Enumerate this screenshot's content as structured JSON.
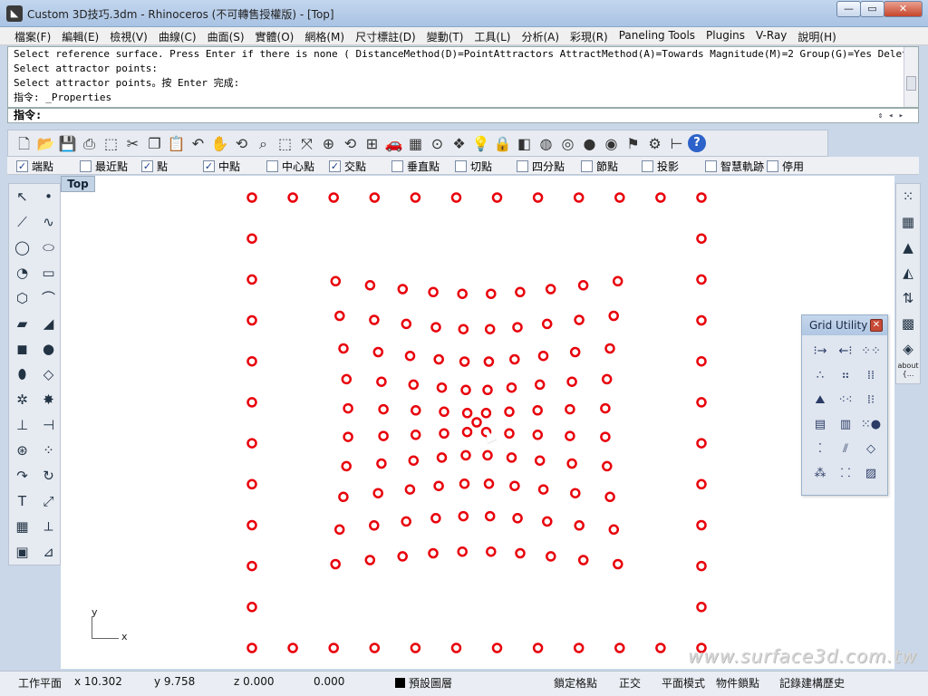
{
  "window": {
    "title": "Custom 3D技巧.3dm - Rhinoceros (不可轉售授權版) - [Top]",
    "app_icon": "rhino-icon",
    "buttons": [
      "—",
      "▭",
      "✕"
    ]
  },
  "menu": [
    "檔案(F)",
    "編輯(E)",
    "檢視(V)",
    "曲線(C)",
    "曲面(S)",
    "實體(O)",
    "網格(M)",
    "尺寸標註(D)",
    "變動(T)",
    "工具(L)",
    "分析(A)",
    "彩現(R)",
    "Paneling Tools",
    "Plugins",
    "V-Ray",
    "說明(H)"
  ],
  "command": {
    "history": [
      "Select reference surface. Press Enter if there is none ( DistanceMethod(D)=PointAttractors  AttractMethod(A)=Towards  Magnitude(M)=2  Group(G)=Yes  DeleteInput(E)=Y",
      "Select attractor points:",
      "Select attractor points。按 Enter 完成:",
      "指令: _Properties"
    ],
    "prompt": "指令:"
  },
  "toolbar_icons": [
    "new-file-icon",
    "open-file-icon",
    "save-icon",
    "print-icon",
    "import-icon",
    "cut-icon",
    "copy-icon",
    "paste-icon",
    "undo-icon",
    "pan-icon",
    "rotate-view-icon",
    "zoom-icon",
    "zoom-window-icon",
    "zoom-extents-icon",
    "zoom-selected-icon",
    "rotate-view-icon",
    "four-viewports-icon",
    "car-icon",
    "grid-icon",
    "point-icon",
    "layer-icon",
    "light-icon",
    "lock-icon",
    "shade-icon",
    "color-wheel-icon",
    "sphere-wire-icon",
    "sphere-icon",
    "sphere-render-icon",
    "flag-icon",
    "settings-icon",
    "tree-icon",
    "help-icon"
  ],
  "osnap": [
    {
      "label": "端點",
      "checked": true
    },
    {
      "label": "最近點",
      "checked": false
    },
    {
      "label": "點",
      "checked": true
    },
    {
      "label": "中點",
      "checked": true
    },
    {
      "label": "中心點",
      "checked": false
    },
    {
      "label": "交點",
      "checked": true
    },
    {
      "label": "垂直點",
      "checked": false
    },
    {
      "label": "切點",
      "checked": false
    },
    {
      "label": "四分點",
      "checked": false
    },
    {
      "label": "節點",
      "checked": false
    },
    {
      "label": "投影",
      "checked": false
    },
    {
      "label": "智慧軌跡",
      "checked": false
    },
    {
      "label": "停用",
      "checked": false
    }
  ],
  "viewport": {
    "name": "Top",
    "axis_x": "x",
    "axis_y": "y",
    "point_color": "#e8000b",
    "watermark": "www.surface3d.com.tw"
  },
  "grid_utility": {
    "title": "Grid Utility",
    "close": "✕"
  },
  "right_tools_label": "about\n{...",
  "status": {
    "plane": "工作平面",
    "x": "x 10.302",
    "y": "y 9.758",
    "z": "z 0.000",
    "distance": "0.000",
    "layer": "預設圖層",
    "snap": "鎖定格點",
    "ortho": "正交",
    "planar": "平面模式",
    "osnap": "物件鎖點",
    "history": "記錄建構歷史"
  }
}
